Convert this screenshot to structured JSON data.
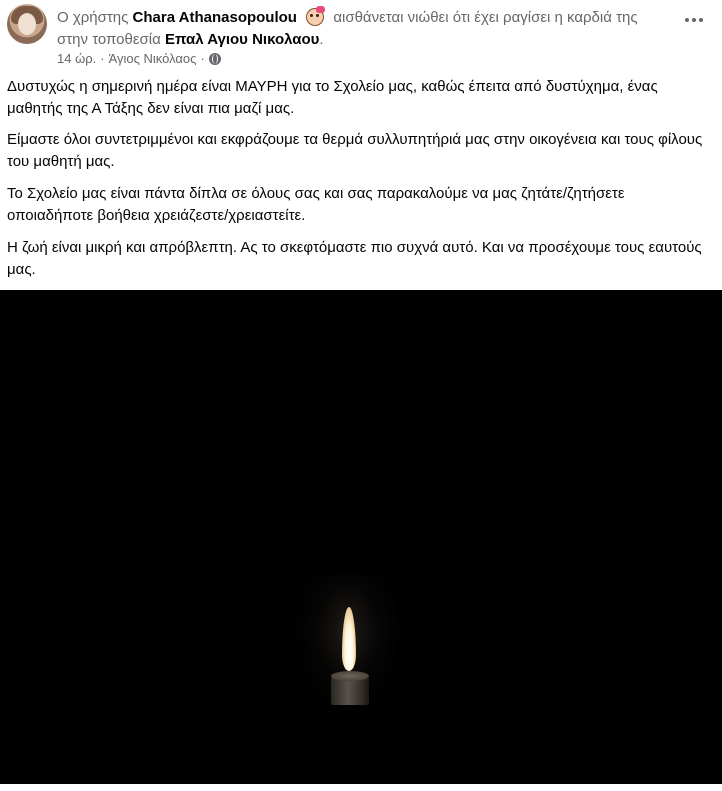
{
  "post": {
    "headline_prefix": "Ο χρήστης",
    "author": "Chara Athanasopoulou",
    "feeling_text": "αισθάνεται νιώθει ότι έχει ραγίσει η καρδιά της στην τοποθεσία",
    "location": "Επαλ Αγιου Νικολαου",
    "trailing_dot": ".",
    "time": "14 ώρ.",
    "separator": "·",
    "place": "Άγιος Νικόλαος",
    "separator2": "·",
    "paragraphs": [
      "Δυστυχώς η σημερινή ημέρα είναι ΜΑΥΡΗ για το Σχολείο μας, καθώς έπειτα από δυστύχημα, ένας μαθητής της Α Τάξης δεν είναι πια μαζί μας.",
      "Είμαστε όλοι συντετριμμένοι και εκφράζουμε τα θερμά συλλυπητήριά μας στην οικογένεια και τους φίλους του μαθητή μας.",
      "Το Σχολείο μας είναι πάντα δίπλα σε όλους σας και σας παρακαλούμε να μας ζητάτε/ζητήσετε οποιαδήποτε βοήθεια χρειάζεστε/χρειαστείτε.",
      "Η ζωή είναι μικρή και απρόβλεπτη. Ας το σκεφτόμαστε πιο συχνά αυτό. Και να προσέχουμε τους εαυτούς μας."
    ]
  },
  "icons": {
    "avatar": "profile-photo",
    "feeling_sticker": "heartbroken-girl-sticker",
    "privacy": "globe-icon",
    "menu": "more-options-icon"
  },
  "colors": {
    "secondary_text": "#65676b",
    "primary_text": "#050505",
    "photo_background": "#000000"
  }
}
